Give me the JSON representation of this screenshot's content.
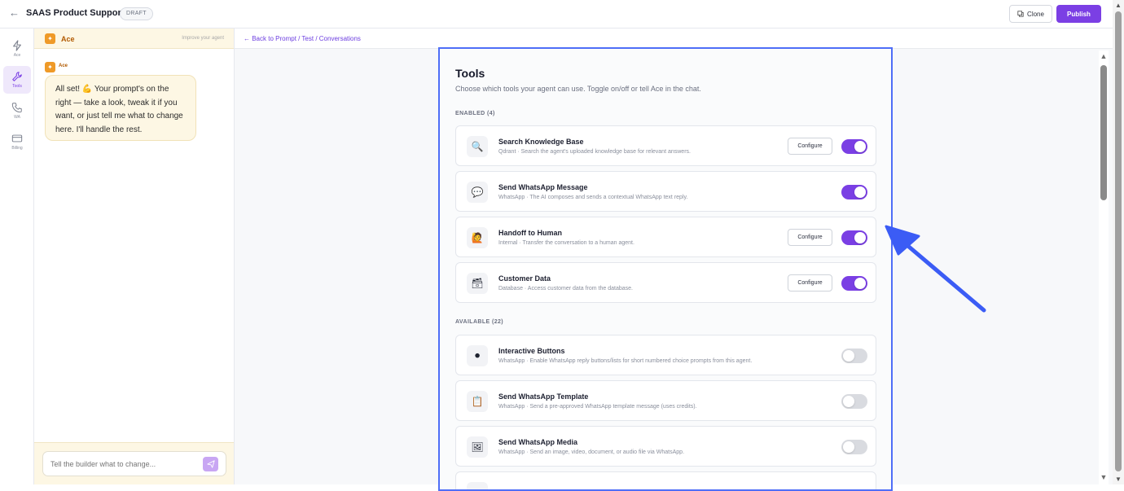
{
  "topbar": {
    "title": "SAAS Product Support",
    "badge": "DRAFT",
    "clone_label": "Clone",
    "publish_label": "Publish"
  },
  "rail": {
    "items": [
      {
        "label": "Ace",
        "icon": "bolt-icon"
      },
      {
        "label": "Tools",
        "icon": "wrench-icon",
        "active": true
      },
      {
        "label": "WA",
        "icon": "phone-icon"
      },
      {
        "label": "Billing",
        "icon": "card-icon"
      }
    ]
  },
  "chat": {
    "header_title": "Ace",
    "improve_label": "Improve your agent",
    "message_author": "Ace",
    "message_text": "All set! 💪 Your prompt's on the right — take a look, tweak it if you want, or just tell me what to change here. I'll handle the rest.",
    "input_placeholder": "Tell the builder what to change..."
  },
  "main": {
    "breadcrumb": "← Back to Prompt / Test / Conversations",
    "tools_title": "Tools",
    "tools_subtitle": "Choose which tools your agent can use. Toggle on/off or tell Ace in the chat.",
    "enabled_label": "ENABLED (4)",
    "available_label": "AVAILABLE (22)",
    "configure_label": "Configure",
    "enabled_tools": [
      {
        "name": "Search Knowledge Base",
        "desc": "Qdrant · Search the agent's uploaded knowledge base for relevant answers.",
        "icon": "🔍",
        "configurable": true,
        "on": true
      },
      {
        "name": "Send WhatsApp Message",
        "desc": "WhatsApp · The AI composes and sends a contextual WhatsApp text reply.",
        "icon": "💬",
        "configurable": false,
        "on": true
      },
      {
        "name": "Handoff to Human",
        "desc": "Internal · Transfer the conversation to a human agent.",
        "icon": "🙋",
        "configurable": true,
        "on": true
      },
      {
        "name": "Customer Data",
        "desc": "Database · Access customer data from the database.",
        "icon": "🗃",
        "configurable": true,
        "on": true
      }
    ],
    "available_tools": [
      {
        "name": "Interactive Buttons",
        "desc": "WhatsApp · Enable WhatsApp reply buttons/lists for short numbered choice prompts from this agent.",
        "icon": "⚫",
        "on": false
      },
      {
        "name": "Send WhatsApp Template",
        "desc": "WhatsApp · Send a pre-approved WhatsApp template message (uses credits).",
        "icon": "📋",
        "on": false
      },
      {
        "name": "Send WhatsApp Media",
        "desc": "WhatsApp · Send an image, video, document, or audio file via WhatsApp.",
        "icon": "🖼",
        "on": false
      }
    ]
  },
  "colors": {
    "accent": "#7b3fe4",
    "highlight_border": "#4f6ef7",
    "ace_orange": "#ef9a28"
  }
}
